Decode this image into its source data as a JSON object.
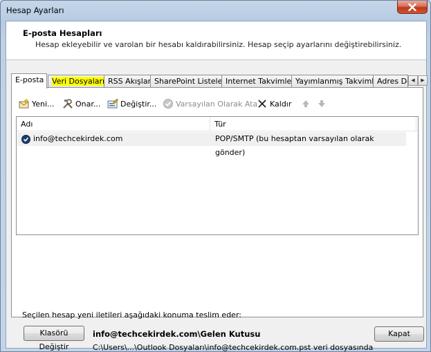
{
  "window": {
    "title": "Hesap Ayarları"
  },
  "header": {
    "title": "E-posta Hesapları",
    "description": "Hesap ekleyebilir ve varolan bir hesabı kaldırabilirsiniz. Hesap seçip ayarlarını değiştirebilirsiniz."
  },
  "tabs": [
    {
      "label": "E-posta",
      "active": true
    },
    {
      "label": "Veri Dosyaları",
      "highlighted": true
    },
    {
      "label": "RSS Akışları"
    },
    {
      "label": "SharePoint Listeleri"
    },
    {
      "label": "Internet Takvimleri"
    },
    {
      "label": "Yayımlanmış Takvimler"
    },
    {
      "label": "Adres De"
    }
  ],
  "toolbar": {
    "new_label": "Yeni...",
    "repair_label": "Onar...",
    "change_label": "Değiştir...",
    "set_default_label": "Varsayılan Olarak Ata",
    "remove_label": "Kaldır"
  },
  "account_list": {
    "columns": [
      "Adı",
      "Tür"
    ],
    "rows": [
      {
        "name": "info@techcekirdek.com",
        "type": "POP/SMTP (bu hesaptan varsayılan olarak gönder)"
      }
    ]
  },
  "delivery": {
    "label": "Seçilen hesap yeni iletileri aşağıdaki konuma teslim eder:",
    "change_folder_label": "Klasörü Değiştir",
    "location": "info@techcekirdek.com\\Gelen Kutusu",
    "data_file": "C:\\Users\\...\\Outlook Dosyaları\\info@techcekirdek.com.pst veri dosyasında"
  },
  "footer": {
    "close_label": "Kapat"
  },
  "colors": {
    "highlight": "#ffff00",
    "close_button": "#c1361a"
  }
}
